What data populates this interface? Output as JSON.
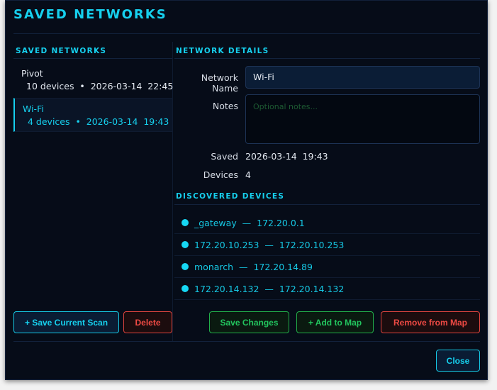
{
  "title": "SAVED NETWORKS",
  "left": {
    "header": "SAVED NETWORKS",
    "networks": [
      {
        "name": "Pivot",
        "meta": "10 devices  •  2026-03-14  22:45"
      },
      {
        "name": "Wi-Fi",
        "meta": "4 devices  •  2026-03-14  19:43"
      }
    ]
  },
  "details": {
    "header": "NETWORK DETAILS",
    "name_label": "Network Name",
    "name_value": "Wi-Fi",
    "notes_label": "Notes",
    "notes_placeholder": "Optional notes...",
    "saved_label": "Saved",
    "saved_value": "2026-03-14  19:43",
    "devices_label": "Devices",
    "devices_value": "4"
  },
  "devices": {
    "header": "DISCOVERED DEVICES",
    "items": [
      {
        "text": "_gateway  —  172.20.0.1"
      },
      {
        "text": "172.20.10.253  —  172.20.10.253"
      },
      {
        "text": "monarch  —  172.20.14.89"
      },
      {
        "text": "172.20.14.132  —  172.20.14.132"
      }
    ]
  },
  "buttons": {
    "save_scan": "+ Save Current Scan",
    "delete": "Delete",
    "save_changes": "Save Changes",
    "add_map": "+ Add to Map",
    "remove_map": "Remove from Map",
    "close": "Close"
  },
  "colors": {
    "accent": "#16d0ee",
    "danger": "#ef4a44",
    "success": "#22c55e",
    "background": "#060c18"
  }
}
